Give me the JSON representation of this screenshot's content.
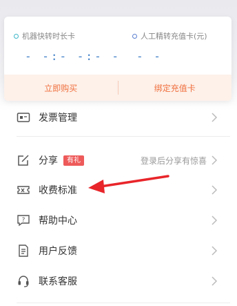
{
  "card": {
    "quota_left": {
      "title": "机器快转时长卡",
      "value": "- -:- -:- -"
    },
    "quota_right": {
      "title": "人工精转充值卡(元)",
      "value": "- -"
    },
    "actions": {
      "buy": "立即购买",
      "bind": "绑定充值卡"
    }
  },
  "menu": {
    "invoice": "发票管理",
    "share": "分享",
    "share_badge": "有礼",
    "share_hint": "登录后分享有惊喜",
    "pricing": "收费标准",
    "help": "帮助中心",
    "feedback": "用户反馈",
    "contact": "联系客服"
  },
  "colors": {
    "accent": "#f0703e",
    "quota_value": "#3f7fc7",
    "annotation_arrow": "#e8252a",
    "badge": "#ee5a5a"
  },
  "icons": [
    "ticket-icon",
    "share-edit-icon",
    "pricing-ticket-icon",
    "help-chat-icon",
    "feedback-doc-icon",
    "headset-icon",
    "chevron-right-icon"
  ]
}
